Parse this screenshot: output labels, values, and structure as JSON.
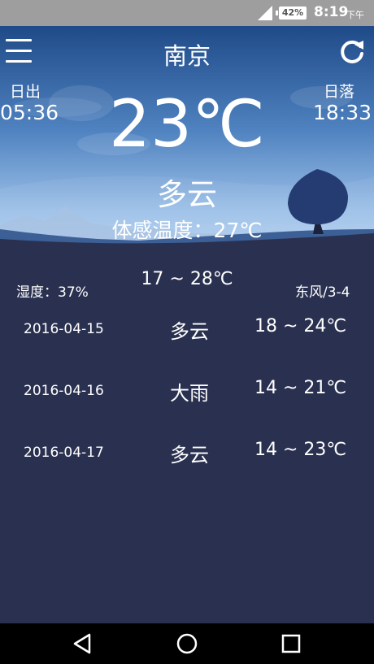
{
  "status_bar": {
    "battery": "42%",
    "time": "8:19",
    "ampm": "下午"
  },
  "header": {
    "city": "南京",
    "menu_icon": "menu-icon",
    "refresh_icon": "refresh-icon"
  },
  "sun": {
    "sunrise_label": "日出",
    "sunrise_time": "05:36",
    "sunset_label": "日落",
    "sunset_time": "18:33"
  },
  "current": {
    "temperature": "23℃",
    "condition": "多云",
    "feels_like": "体感温度：27℃",
    "humidity": "湿度：37%",
    "range": "17 ~ 28℃",
    "wind": "东风/3-4"
  },
  "forecast": [
    {
      "date": "2016-04-15",
      "weather": "多云",
      "range": "18 ~ 24℃"
    },
    {
      "date": "2016-04-16",
      "weather": "大雨",
      "range": "14 ~ 21℃"
    },
    {
      "date": "2016-04-17",
      "weather": "多云",
      "range": "14 ~ 23℃"
    }
  ],
  "colors": {
    "background": "#2a3150",
    "sky_top": "#234f8c",
    "sky_bottom": "#9cc0e8",
    "status_bar": "#9e9e9e"
  }
}
